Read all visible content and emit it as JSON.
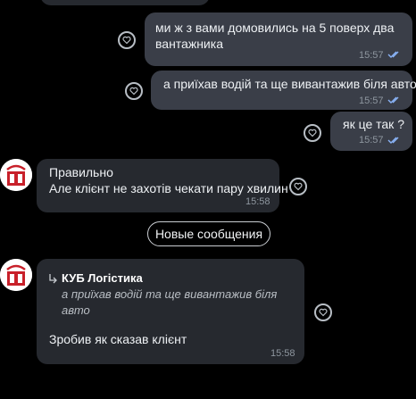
{
  "messages": [
    {
      "text_lines": [
        "ми ж з вами домовились на 5 поверх два",
        "вантажника"
      ],
      "time": "15:57",
      "read": true
    },
    {
      "text_lines": [
        "а приїхав водій та ще вивантажив біля авто"
      ],
      "time": "15:57",
      "read": true
    },
    {
      "text_lines": [
        "як це так ?"
      ],
      "time": "15:57",
      "read": true
    },
    {
      "text_lines": [
        "Правильно",
        "Але клієнт не захотів чекати пару хвилин"
      ],
      "time": "15:58"
    },
    {
      "text": "Зробив як сказав клієнт",
      "time": "15:58",
      "reply": {
        "author": "КУБ Логістика",
        "quote_lines": [
          "а приїхав водій та ще вивантажив біля",
          "авто"
        ]
      }
    }
  ],
  "new_messages_label": "Новые сообщения",
  "colors": {
    "outgoing": "#3a3e48",
    "incoming": "#26292f",
    "check": "#8ab4f8",
    "logo_red": "#c8202a"
  },
  "icons": {
    "reaction": "heart-outline-icon",
    "read": "double-check-icon",
    "reply": "reply-arrow-icon"
  }
}
